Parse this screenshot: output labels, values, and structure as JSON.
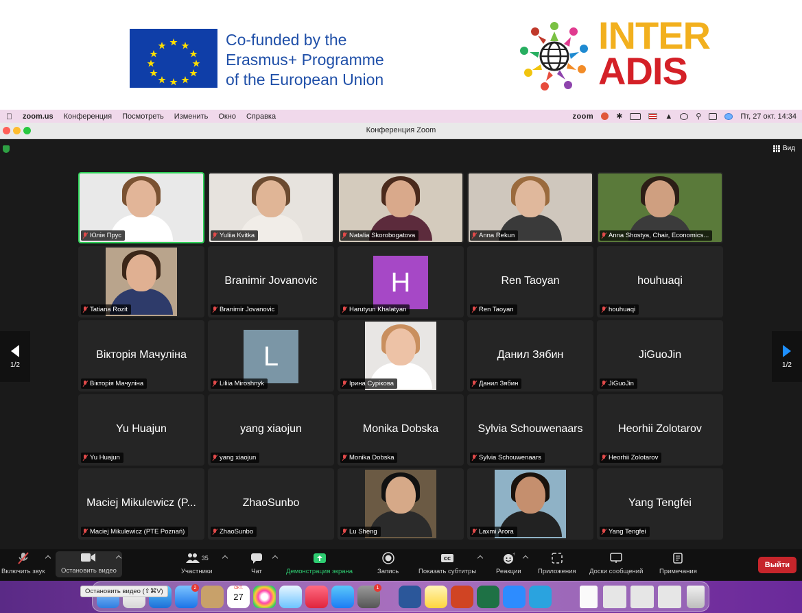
{
  "banner": {
    "eu_text_lines": [
      "Co-funded by the",
      "Erasmus+ Programme",
      "of the European Union"
    ],
    "logo_line1": "INTER",
    "logo_line2": "ADIS"
  },
  "menubar": {
    "app": "zoom.us",
    "items": [
      "Конференция",
      "Посмотреть",
      "Изменить",
      "Окно",
      "Справка"
    ],
    "zoom_label": "zoom",
    "datetime": "Пт, 27 окт.  14:34"
  },
  "window": {
    "title": "Конференция Zoom"
  },
  "view_button": "Вид",
  "page_indicator": "1/2",
  "participants": [
    {
      "label": "Юлія Прус",
      "video": true,
      "active": true,
      "bg": "#e9e9e9",
      "hair": "#7a5232",
      "shirt": "#ffffff",
      "skin": "#e2b598"
    },
    {
      "label": "Yuliia Kvitka",
      "video": true,
      "bg": "#e7e3de",
      "hair": "#6b4a30",
      "shirt": "#f1ede8",
      "skin": "#e0b596"
    },
    {
      "label": "Natalia Skorobogatova",
      "video": true,
      "bg": "#d4cbbd",
      "hair": "#4a2a1c",
      "shirt": "#5c2b3c",
      "skin": "#d9a98b"
    },
    {
      "label": "Anna Rekun",
      "video": true,
      "bg": "#cfc7bd",
      "hair": "#9a6a3d",
      "shirt": "#3a3a3a",
      "skin": "#e0b89c"
    },
    {
      "label": "Anna Shostya, Chair, Economics...",
      "video": true,
      "bg": "#5a7a3a",
      "hair": "#2c1e16",
      "shirt": "#3b3b3b",
      "skin": "#cf9f80"
    },
    {
      "label": "Tatiana Rozit",
      "video": true,
      "small": true,
      "bg": "#b9a48c",
      "hair": "#3b2618",
      "shirt": "#2e3b6a",
      "skin": "#e0b092"
    },
    {
      "label": "Branimir Jovanovic",
      "name": "Branimir Jovanovic"
    },
    {
      "label": "Harutyun Khalatyan",
      "avatar": "H",
      "avatar_color": "#a648c6"
    },
    {
      "label": "Ren Taoyan",
      "name": "Ren Taoyan"
    },
    {
      "label": "houhuaqi",
      "name": "houhuaqi"
    },
    {
      "label": "Вікторія Мачуліна",
      "name": "Вікторія Мачуліна"
    },
    {
      "label": "Liliia Miroshnyk",
      "avatar": "L",
      "avatar_color": "#7b96a6"
    },
    {
      "label": "Ірина Сурікова",
      "video": true,
      "small": true,
      "bg": "#e8e6e4",
      "hair": "#c98f5e",
      "shirt": "#ffffff",
      "skin": "#edc2a6"
    },
    {
      "label": "Данил Зябин",
      "name": "Данил Зябин"
    },
    {
      "label": "JiGuoJin",
      "name": "JiGuoJin"
    },
    {
      "label": "Yu Huajun",
      "name": "Yu Huajun"
    },
    {
      "label": "yang xiaojun",
      "name": "yang xiaojun"
    },
    {
      "label": "Monika Dobska",
      "name": "Monika Dobska"
    },
    {
      "label": "Sylvia Schouwenaars",
      "name": "Sylvia Schouwenaars"
    },
    {
      "label": "Heorhii Zolotarov",
      "name": "Heorhii Zolotarov"
    },
    {
      "label": "Maciej Mikulewicz (PTE Poznań)",
      "name": "Maciej Mikulewicz (P..."
    },
    {
      "label": "ZhaoSunbo",
      "name": "ZhaoSunbo"
    },
    {
      "label": "Lu Sheng",
      "video": true,
      "small": true,
      "bg": "#6b5a44",
      "hair": "#111111",
      "shirt": "#2b2b2b",
      "skin": "#d6a988"
    },
    {
      "label": "Laxmi Arora",
      "video": true,
      "small": true,
      "bg": "#8fb2c6",
      "hair": "#1a120c",
      "shirt": "#222222",
      "skin": "#c58f6e"
    },
    {
      "label": "Yang Tengfei",
      "name": "Yang Tengfei"
    }
  ],
  "toolbar": {
    "unmute": "Включить звук",
    "stop_video": "Остановить видео",
    "participants": "Участники",
    "participants_count": "35",
    "chat": "Чат",
    "share": "Демонстрация экрана",
    "record": "Запись",
    "captions": "Показать субтитры",
    "reactions": "Реакции",
    "apps": "Приложения",
    "whiteboards": "Доски сообщений",
    "notes": "Примечания",
    "leave": "Выйти"
  },
  "dock": {
    "tooltip": "Остановить видео (⇧⌘V)",
    "calendar_month": "ОКТ.",
    "calendar_day": "27",
    "mail_badge": "2",
    "settings_badge": "1"
  },
  "colors": {
    "active_border": "#2ed158",
    "leave_button": "#c6252b",
    "share_green": "#2ecc71",
    "muted_red": "#e24a4a"
  }
}
